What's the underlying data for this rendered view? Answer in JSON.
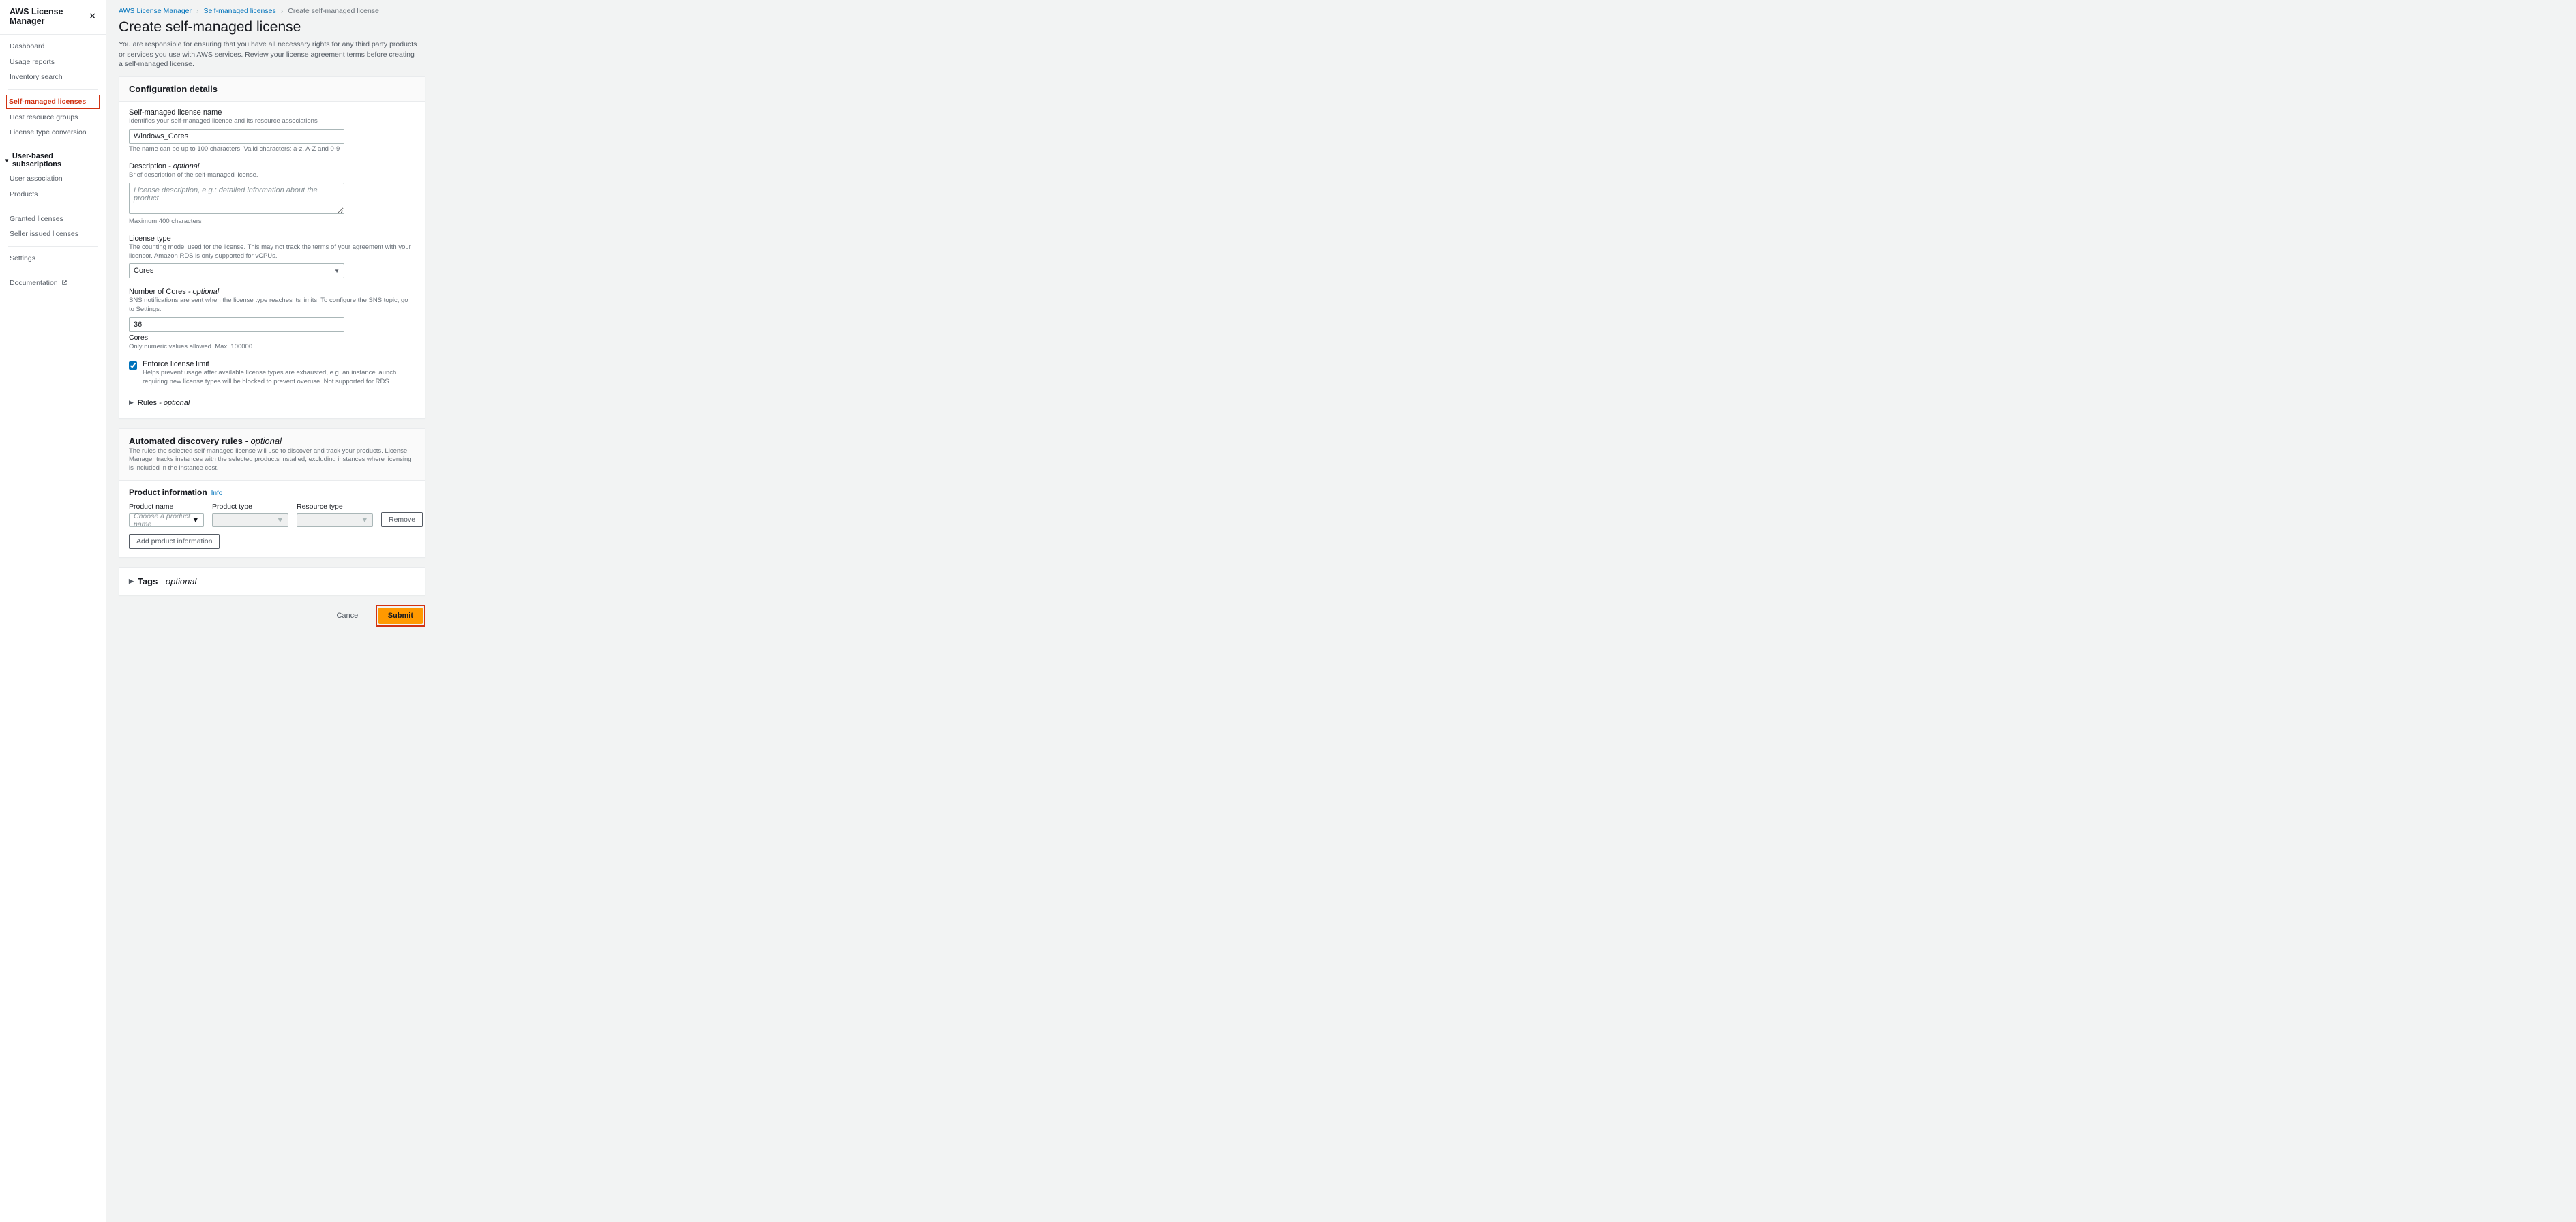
{
  "sidebar": {
    "title": "AWS License Manager",
    "groups": [
      {
        "items": [
          {
            "label": "Dashboard"
          },
          {
            "label": "Usage reports"
          },
          {
            "label": "Inventory search"
          }
        ]
      },
      {
        "items": [
          {
            "label": "Self-managed licenses",
            "active": true
          },
          {
            "label": "Host resource groups"
          },
          {
            "label": "License type conversion"
          }
        ]
      },
      {
        "section": "User-based subscriptions",
        "items": [
          {
            "label": "User association"
          },
          {
            "label": "Products"
          }
        ]
      },
      {
        "items": [
          {
            "label": "Granted licenses"
          },
          {
            "label": "Seller issued licenses"
          }
        ]
      },
      {
        "items": [
          {
            "label": "Settings"
          }
        ]
      },
      {
        "items": [
          {
            "label": "Documentation",
            "external": true
          }
        ],
        "noborder": true
      }
    ]
  },
  "breadcrumbs": {
    "a": "AWS License Manager",
    "b": "Self-managed licenses",
    "c": "Create self-managed license"
  },
  "page": {
    "title": "Create self-managed license",
    "desc": "You are responsible for ensuring that you have all necessary rights for any third party products or services you use with AWS services. Review your license agreement terms before creating a self-managed license."
  },
  "config": {
    "header": "Configuration details",
    "name": {
      "label": "Self-managed license name",
      "hint": "Identifies your self-managed license and its resource associations",
      "value": "Windows_Cores",
      "help": "The name can be up to 100 characters. Valid characters: a-z, A-Z and 0-9"
    },
    "desc": {
      "label": "Description",
      "optional": " - optional",
      "hint": "Brief description of the self-managed license.",
      "placeholder": "License description, e.g.: detailed information about the product",
      "help": "Maximum 400 characters"
    },
    "ltype": {
      "label": "License type",
      "hint": "The counting model used for the license. This may not track the terms of your agreement with your licensor. Amazon RDS is only supported for vCPUs.",
      "value": "Cores"
    },
    "numcores": {
      "label": "Number of Cores",
      "optional": " - optional",
      "hint": "SNS notifications are sent when the license type reaches its limits. To configure the SNS topic, go to Settings.",
      "value": "36",
      "unit": "Cores",
      "help": "Only numeric values allowed. Max: 100000"
    },
    "enforce": {
      "label": "Enforce license limit",
      "help": "Helps prevent usage after available license types are exhausted, e.g. an instance launch requiring new license types will be blocked to prevent overuse. Not supported for RDS."
    },
    "rules": {
      "label": "Rules",
      "optional": " - optional"
    }
  },
  "auto": {
    "header": "Automated discovery rules",
    "optional": " - optional",
    "sub": "The rules the selected self-managed license will use to discover and track your products. License Manager tracks instances with the selected products installed, excluding instances where licensing is included in the instance cost.",
    "prodinfo": "Product information",
    "info": "Info",
    "cols": {
      "name": "Product name",
      "type": "Product type",
      "res": "Resource type"
    },
    "name_placeholder": "Choose a product name",
    "remove": "Remove",
    "add": "Add product information"
  },
  "tags": {
    "label": "Tags",
    "optional": " - optional"
  },
  "footer": {
    "cancel": "Cancel",
    "submit": "Submit"
  }
}
